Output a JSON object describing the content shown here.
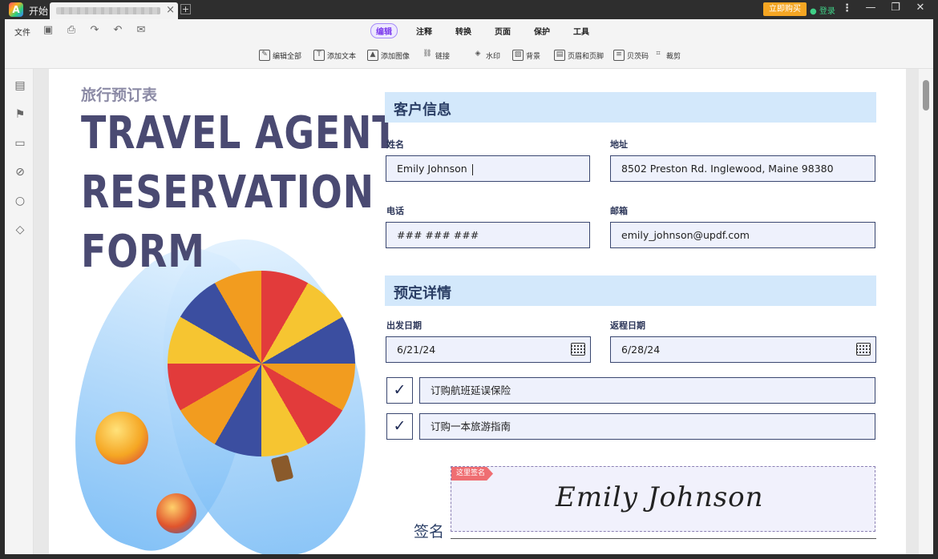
{
  "titlebar": {
    "home_tab": "开始",
    "doc_close": "×",
    "new_tab": "+",
    "buy": "立即购买",
    "login": "登录",
    "more": "⋮",
    "minimize": "—",
    "maximize": "❐",
    "close": "✕"
  },
  "toolbar": {
    "file": "文件",
    "tabs": [
      "编辑",
      "注释",
      "转换",
      "页面",
      "保护",
      "工具"
    ],
    "active_tab": "编辑",
    "tools": [
      "编辑全部",
      "添加文本",
      "添加图像",
      "链接",
      "水印",
      "背景",
      "页眉和页脚",
      "贝茨码",
      "裁剪"
    ]
  },
  "form": {
    "subtitle": "旅行预订表",
    "title_lines": [
      "TRAVEL AGENT",
      "RESERVATION",
      "FORM"
    ],
    "customer_section": "客户信息",
    "name_label": "姓名",
    "name_value": "Emily Johnson",
    "address_label": "地址",
    "address_value": "8502 Preston Rd. Inglewood, Maine 98380",
    "phone_label": "电话",
    "phone_value": "### ### ###",
    "email_label": "邮箱",
    "email_value": "emily_johnson@updf.com",
    "booking_section": "预定详情",
    "depart_label": "出发日期",
    "depart_value": "6/21/24",
    "return_label": "返程日期",
    "return_value": "6/28/24",
    "option1": "订购航班延误保险",
    "option2": "订购一本旅游指南",
    "check_mark": "✓",
    "sign_here": "这里签名",
    "signature": "Emily Johnson",
    "signature_label": "签名"
  },
  "colors": {
    "accent": "#7c3aed",
    "section_bg": "#d3e8fb",
    "title": "#4a4a72",
    "field_bg": "#eef1fc",
    "buy": "#f5a623",
    "sign_tag": "#ef6e72"
  }
}
